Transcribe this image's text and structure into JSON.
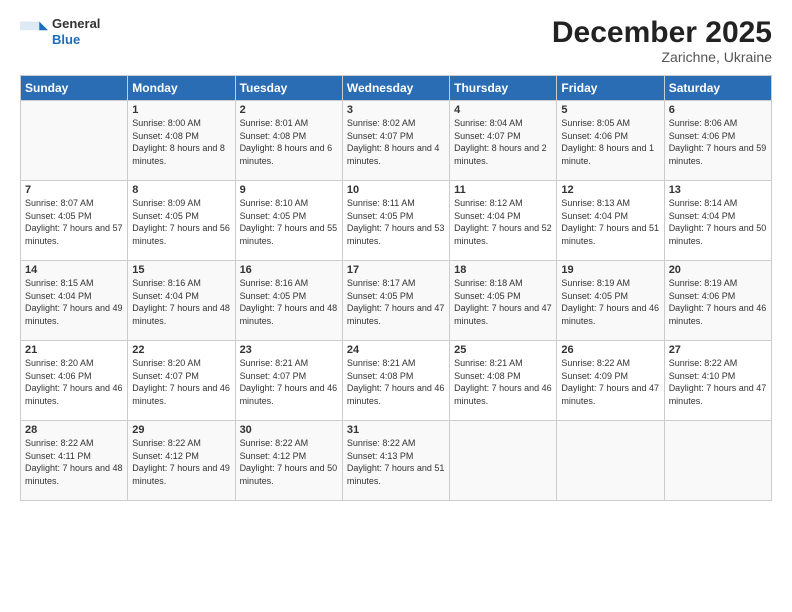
{
  "logo": {
    "general": "General",
    "blue": "Blue"
  },
  "header": {
    "month": "December 2025",
    "location": "Zarichne, Ukraine"
  },
  "days_of_week": [
    "Sunday",
    "Monday",
    "Tuesday",
    "Wednesday",
    "Thursday",
    "Friday",
    "Saturday"
  ],
  "weeks": [
    [
      {
        "day": "",
        "info": ""
      },
      {
        "day": "1",
        "info": "Sunrise: 8:00 AM\nSunset: 4:08 PM\nDaylight: 8 hours\nand 8 minutes."
      },
      {
        "day": "2",
        "info": "Sunrise: 8:01 AM\nSunset: 4:08 PM\nDaylight: 8 hours\nand 6 minutes."
      },
      {
        "day": "3",
        "info": "Sunrise: 8:02 AM\nSunset: 4:07 PM\nDaylight: 8 hours\nand 4 minutes."
      },
      {
        "day": "4",
        "info": "Sunrise: 8:04 AM\nSunset: 4:07 PM\nDaylight: 8 hours\nand 2 minutes."
      },
      {
        "day": "5",
        "info": "Sunrise: 8:05 AM\nSunset: 4:06 PM\nDaylight: 8 hours\nand 1 minute."
      },
      {
        "day": "6",
        "info": "Sunrise: 8:06 AM\nSunset: 4:06 PM\nDaylight: 7 hours\nand 59 minutes."
      }
    ],
    [
      {
        "day": "7",
        "info": "Sunrise: 8:07 AM\nSunset: 4:05 PM\nDaylight: 7 hours\nand 57 minutes."
      },
      {
        "day": "8",
        "info": "Sunrise: 8:09 AM\nSunset: 4:05 PM\nDaylight: 7 hours\nand 56 minutes."
      },
      {
        "day": "9",
        "info": "Sunrise: 8:10 AM\nSunset: 4:05 PM\nDaylight: 7 hours\nand 55 minutes."
      },
      {
        "day": "10",
        "info": "Sunrise: 8:11 AM\nSunset: 4:05 PM\nDaylight: 7 hours\nand 53 minutes."
      },
      {
        "day": "11",
        "info": "Sunrise: 8:12 AM\nSunset: 4:04 PM\nDaylight: 7 hours\nand 52 minutes."
      },
      {
        "day": "12",
        "info": "Sunrise: 8:13 AM\nSunset: 4:04 PM\nDaylight: 7 hours\nand 51 minutes."
      },
      {
        "day": "13",
        "info": "Sunrise: 8:14 AM\nSunset: 4:04 PM\nDaylight: 7 hours\nand 50 minutes."
      }
    ],
    [
      {
        "day": "14",
        "info": "Sunrise: 8:15 AM\nSunset: 4:04 PM\nDaylight: 7 hours\nand 49 minutes."
      },
      {
        "day": "15",
        "info": "Sunrise: 8:16 AM\nSunset: 4:04 PM\nDaylight: 7 hours\nand 48 minutes."
      },
      {
        "day": "16",
        "info": "Sunrise: 8:16 AM\nSunset: 4:05 PM\nDaylight: 7 hours\nand 48 minutes."
      },
      {
        "day": "17",
        "info": "Sunrise: 8:17 AM\nSunset: 4:05 PM\nDaylight: 7 hours\nand 47 minutes."
      },
      {
        "day": "18",
        "info": "Sunrise: 8:18 AM\nSunset: 4:05 PM\nDaylight: 7 hours\nand 47 minutes."
      },
      {
        "day": "19",
        "info": "Sunrise: 8:19 AM\nSunset: 4:05 PM\nDaylight: 7 hours\nand 46 minutes."
      },
      {
        "day": "20",
        "info": "Sunrise: 8:19 AM\nSunset: 4:06 PM\nDaylight: 7 hours\nand 46 minutes."
      }
    ],
    [
      {
        "day": "21",
        "info": "Sunrise: 8:20 AM\nSunset: 4:06 PM\nDaylight: 7 hours\nand 46 minutes."
      },
      {
        "day": "22",
        "info": "Sunrise: 8:20 AM\nSunset: 4:07 PM\nDaylight: 7 hours\nand 46 minutes."
      },
      {
        "day": "23",
        "info": "Sunrise: 8:21 AM\nSunset: 4:07 PM\nDaylight: 7 hours\nand 46 minutes."
      },
      {
        "day": "24",
        "info": "Sunrise: 8:21 AM\nSunset: 4:08 PM\nDaylight: 7 hours\nand 46 minutes."
      },
      {
        "day": "25",
        "info": "Sunrise: 8:21 AM\nSunset: 4:08 PM\nDaylight: 7 hours\nand 46 minutes."
      },
      {
        "day": "26",
        "info": "Sunrise: 8:22 AM\nSunset: 4:09 PM\nDaylight: 7 hours\nand 47 minutes."
      },
      {
        "day": "27",
        "info": "Sunrise: 8:22 AM\nSunset: 4:10 PM\nDaylight: 7 hours\nand 47 minutes."
      }
    ],
    [
      {
        "day": "28",
        "info": "Sunrise: 8:22 AM\nSunset: 4:11 PM\nDaylight: 7 hours\nand 48 minutes."
      },
      {
        "day": "29",
        "info": "Sunrise: 8:22 AM\nSunset: 4:12 PM\nDaylight: 7 hours\nand 49 minutes."
      },
      {
        "day": "30",
        "info": "Sunrise: 8:22 AM\nSunset: 4:12 PM\nDaylight: 7 hours\nand 50 minutes."
      },
      {
        "day": "31",
        "info": "Sunrise: 8:22 AM\nSunset: 4:13 PM\nDaylight: 7 hours\nand 51 minutes."
      },
      {
        "day": "",
        "info": ""
      },
      {
        "day": "",
        "info": ""
      },
      {
        "day": "",
        "info": ""
      }
    ]
  ]
}
